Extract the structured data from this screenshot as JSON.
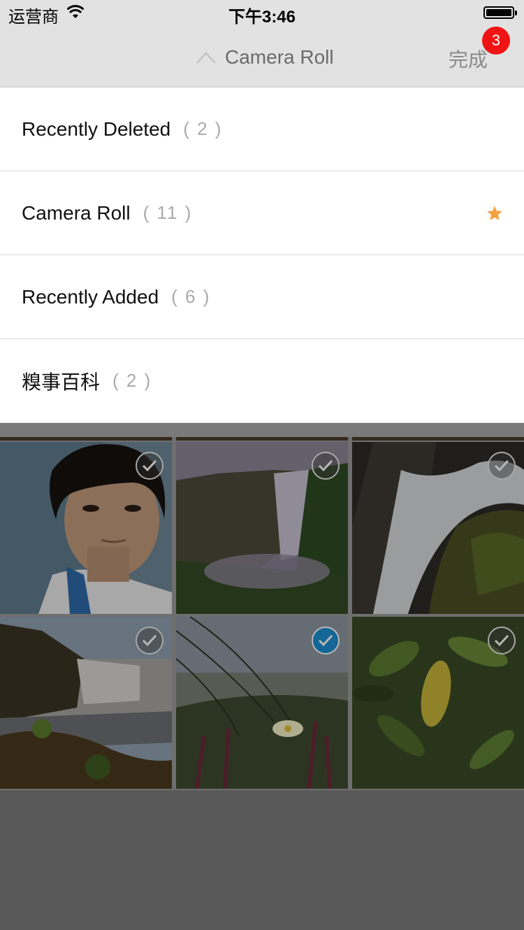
{
  "status_bar": {
    "carrier": "运营商",
    "time": "下午3:46"
  },
  "nav": {
    "title": "Camera Roll",
    "done_label": "完成",
    "badge_count": "3"
  },
  "albums": [
    {
      "name": "Recently Deleted",
      "count": "( 2 )",
      "favorite": false
    },
    {
      "name": "Camera Roll",
      "count": "( 11 )",
      "favorite": true
    },
    {
      "name": "Recently Added",
      "count": "( 6 )",
      "favorite": false
    },
    {
      "name": "糗事百科",
      "count": "( 2 )",
      "favorite": false
    }
  ],
  "photos": [
    {
      "subject": "portrait",
      "selected": false
    },
    {
      "subject": "waterfall-cliff",
      "selected": false
    },
    {
      "subject": "waterfall-rocks",
      "selected": false
    },
    {
      "subject": "waterfall-coast",
      "selected": false
    },
    {
      "subject": "flower-grass",
      "selected": true
    },
    {
      "subject": "leaves",
      "selected": false
    }
  ],
  "colors": {
    "accent_badge": "#f01414",
    "star": "#f5a040",
    "check_selected": "#1c8ed0"
  }
}
